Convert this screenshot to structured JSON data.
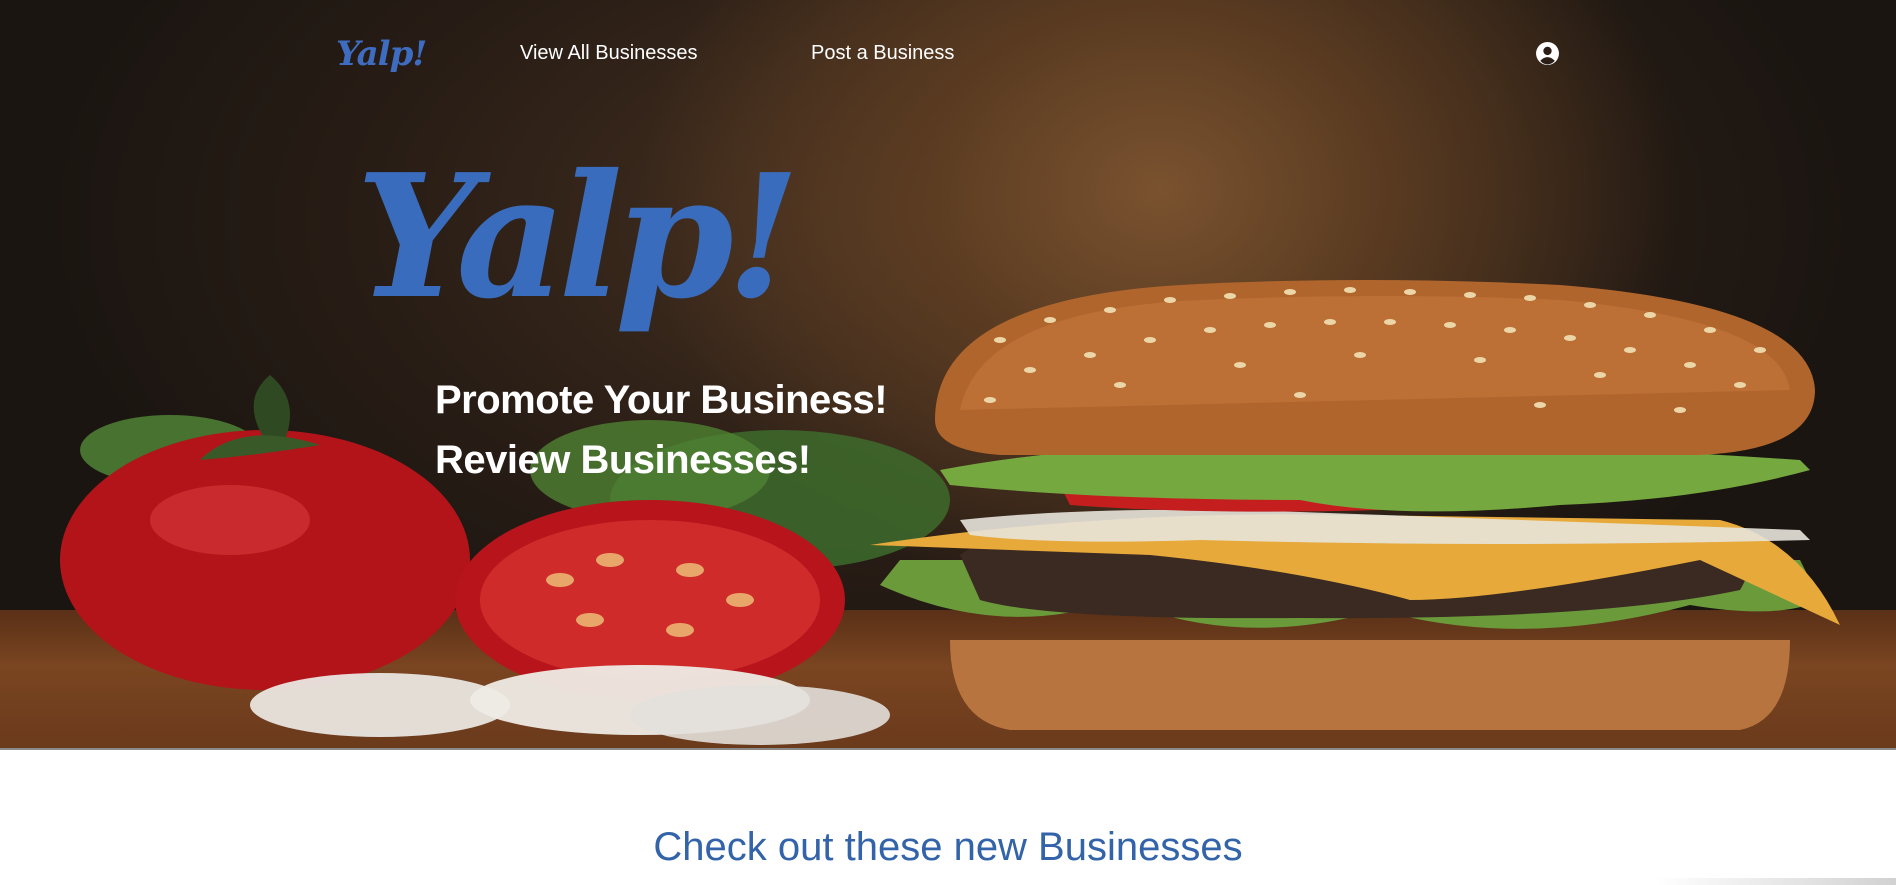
{
  "navbar": {
    "logo": "Yalp!",
    "links": [
      {
        "label": "View All Businesses"
      },
      {
        "label": "Post a Business"
      }
    ],
    "user_icon": "user-circle-icon"
  },
  "hero": {
    "logo": "Yalp!",
    "tagline_1": "Promote Your Business!",
    "tagline_2": "Review Businesses!"
  },
  "section": {
    "title": "Check out these new Businesses"
  },
  "colors": {
    "brand_blue": "#3a6cbe",
    "title_blue": "#3363a8",
    "nav_text": "#ffffff"
  }
}
